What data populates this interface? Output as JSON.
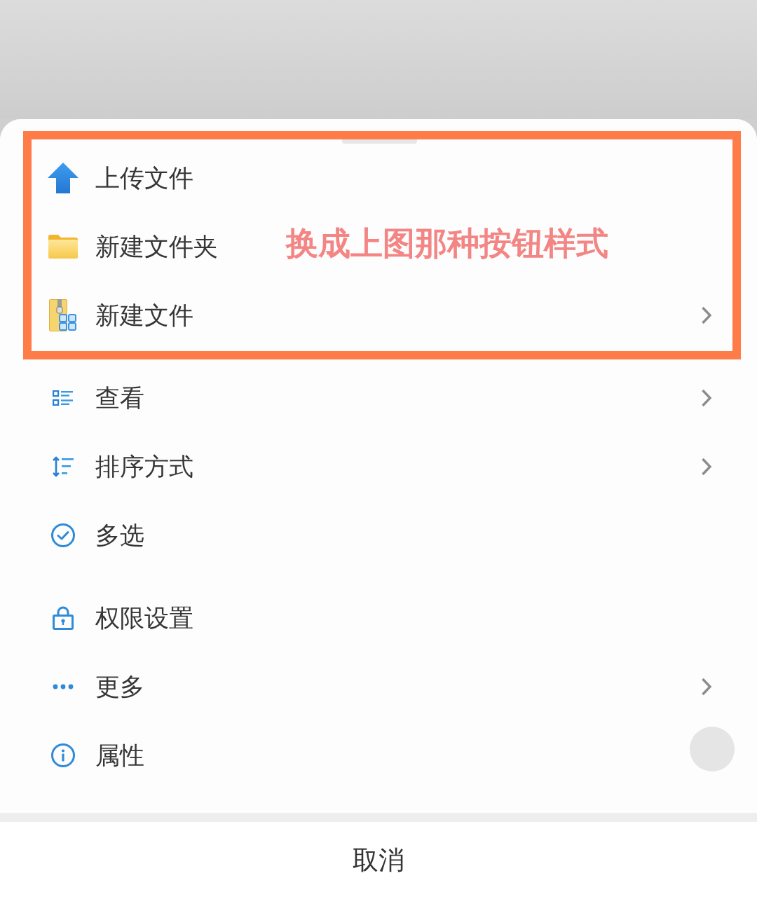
{
  "sheet": {
    "groups": [
      {
        "highlighted": true,
        "annotation": "换成上图那种按钮样式",
        "items": [
          {
            "label": "上传文件",
            "has_submenu": false
          },
          {
            "label": "新建文件夹",
            "has_submenu": false
          },
          {
            "label": "新建文件",
            "has_submenu": true
          }
        ]
      },
      {
        "highlighted": false,
        "items": [
          {
            "label": "查看",
            "has_submenu": true
          },
          {
            "label": "排序方式",
            "has_submenu": true
          },
          {
            "label": "多选",
            "has_submenu": false
          }
        ]
      },
      {
        "highlighted": false,
        "items": [
          {
            "label": "权限设置",
            "has_submenu": false
          },
          {
            "label": "更多",
            "has_submenu": true
          },
          {
            "label": "属性",
            "has_submenu": false
          }
        ]
      }
    ],
    "cancel_button": "取消"
  }
}
